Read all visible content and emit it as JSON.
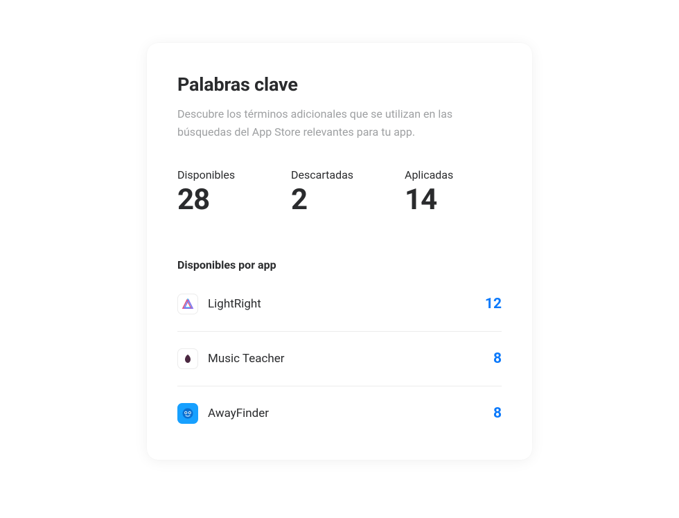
{
  "header": {
    "title": "Palabras clave",
    "subtitle": "Descubre los términos adicionales que se utilizan en las búsquedas del App Store relevantes para tu app."
  },
  "metrics": [
    {
      "label": "Disponibles",
      "value": "28"
    },
    {
      "label": "Descartadas",
      "value": "2"
    },
    {
      "label": "Aplicadas",
      "value": "14"
    }
  ],
  "apps_section": {
    "title": "Disponibles por app",
    "rows": [
      {
        "name": "LightRight",
        "count": "12",
        "icon": "lightright"
      },
      {
        "name": "Music Teacher",
        "count": "8",
        "icon": "musicteacher"
      },
      {
        "name": "AwayFinder",
        "count": "8",
        "icon": "awayfinder"
      }
    ]
  }
}
